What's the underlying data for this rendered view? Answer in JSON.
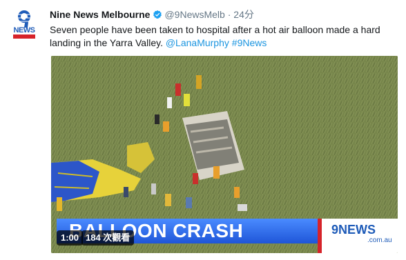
{
  "tweet": {
    "author_name": "Nine News Melbourne",
    "handle": "@9NewsMelb",
    "separator": "·",
    "time": "24分",
    "text_before": "Seven people have been taken to hospital after a hot air balloon made a hard landing in the Yarra Valley. ",
    "mention": "@LanaMurphy",
    "hashtag": "#9News",
    "avatar_news": "NEWS"
  },
  "media": {
    "chyron": "BALLOON CRASH",
    "logo_main": "9NEWS",
    "logo_domain": ".com.au",
    "duration": "1:00",
    "views": "184 次觀看"
  },
  "colors": {
    "link": "#1b95e0",
    "verified": "#1da1f2",
    "brand_blue": "#1e5bb8",
    "brand_red": "#d6232a"
  }
}
